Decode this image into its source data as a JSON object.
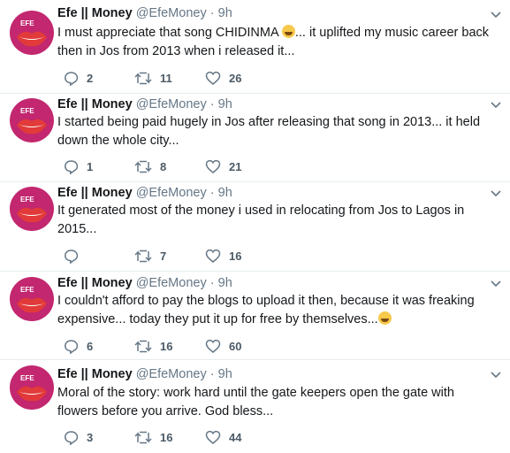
{
  "tweets": [
    {
      "name": "Efe || Money",
      "handle": "@EfeMoney",
      "separator": "·",
      "time": "9h",
      "text_before": "I must appreciate that song CHIDINMA ",
      "emoji": "grinning-face",
      "text_after": "... it uplifted my music career back then in Jos from 2013 when i released it...",
      "replies": "2",
      "retweets": "11",
      "likes": "26"
    },
    {
      "name": "Efe || Money",
      "handle": "@EfeMoney",
      "separator": "·",
      "time": "9h",
      "text_before": "I started being paid hugely in Jos after releasing that song in 2013... it held down the whole city...",
      "emoji": "",
      "text_after": "",
      "replies": "1",
      "retweets": "8",
      "likes": "21"
    },
    {
      "name": "Efe || Money",
      "handle": "@EfeMoney",
      "separator": "·",
      "time": "9h",
      "text_before": "It generated most of the money i used in relocating from Jos to Lagos in 2015...",
      "emoji": "",
      "text_after": "",
      "replies": "",
      "retweets": "7",
      "likes": "16"
    },
    {
      "name": "Efe || Money",
      "handle": "@EfeMoney",
      "separator": "·",
      "time": "9h",
      "text_before": "I couldn't afford to pay the blogs to upload it then, because it was freaking expensive... today they put it up for free by themselves...",
      "emoji": "grinning-face",
      "text_after": "",
      "replies": "6",
      "retweets": "16",
      "likes": "60"
    },
    {
      "name": "Efe || Money",
      "handle": "@EfeMoney",
      "separator": "·",
      "time": "9h",
      "text_before": "Moral of the story: work hard until the gate keepers open the gate with flowers before you arrive. God bless...",
      "emoji": "",
      "text_after": "",
      "replies": "3",
      "retweets": "16",
      "likes": "44"
    }
  ],
  "avatar": {
    "label": "EFE",
    "color": "#c2276f"
  },
  "icons": {
    "reply": "reply-icon",
    "retweet": "retweet-icon",
    "like": "heart-icon",
    "menu": "chevron-down-icon"
  }
}
